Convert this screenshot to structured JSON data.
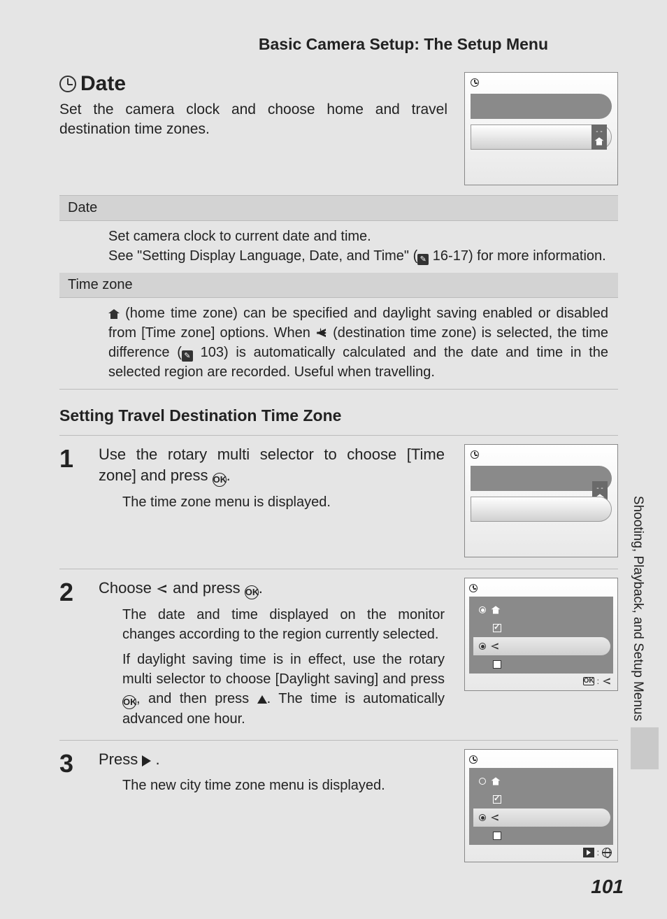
{
  "header": {
    "title": "Basic Camera Setup: The Setup Menu"
  },
  "section": {
    "title": "Date",
    "intro": "Set the camera clock and choose home and travel destination time zones."
  },
  "table": {
    "row1": {
      "head": "Date",
      "body1": "Set camera clock to current date and time.",
      "body2a": "See \"Setting Display Language, Date, and Time\" (",
      "body2b": " 16-17) for more information."
    },
    "row2": {
      "head": "Time zone",
      "body_a": "(home time zone) can be specified and daylight saving enabled or disabled from [Time zone] options. When ",
      "body_b": " (destination time zone) is selected, the time difference (",
      "body_c": " 103) is automatically calculated and the date and time in the selected region are recorded. Useful when travelling."
    }
  },
  "subheading": "Setting Travel Destination Time Zone",
  "steps": {
    "s1": {
      "num": "1",
      "head_a": "Use the rotary multi selector to choose [Time zone] and press ",
      "head_b": ".",
      "sub": "The time zone menu is displayed."
    },
    "s2": {
      "num": "2",
      "head_a": "Choose ",
      "head_b": " and press ",
      "head_c": ".",
      "sub1": "The date and time displayed on the monitor changes according to the region currently selected.",
      "sub2_a": "If daylight saving time is in effect, use the rotary multi selector to choose [Daylight saving] and press ",
      "sub2_b": ", and then press ",
      "sub2_c": ". The time is automatically advanced one hour."
    },
    "s3": {
      "num": "3",
      "head_a": "Press ",
      "head_b": " .",
      "sub": "The new city time zone menu is displayed."
    }
  },
  "side_label": "Shooting, Playback, and Setup Menus",
  "page_number": "101",
  "ok_label": "OK",
  "dashes": "- -"
}
